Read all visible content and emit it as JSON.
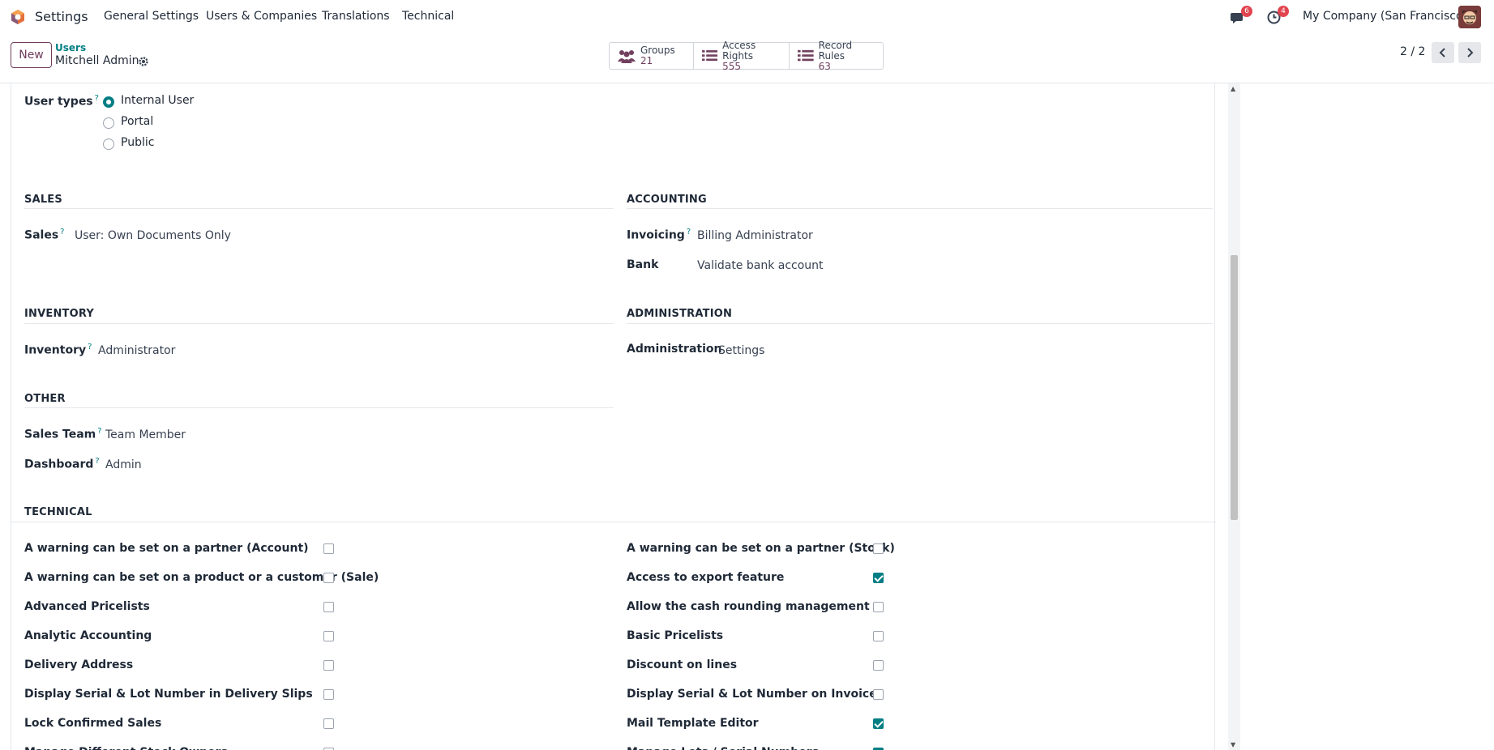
{
  "nav": {
    "app_name": "Settings",
    "menu": [
      "General Settings",
      "Users & Companies",
      "Translations",
      "Technical"
    ],
    "messages_count": "6",
    "activities_count": "4",
    "company": "My Company (San Francisco)"
  },
  "control": {
    "new_label": "New",
    "breadcrumb_parent": "Users",
    "breadcrumb_current": "Mitchell Admin",
    "smart_buttons": [
      {
        "label": "Groups",
        "value": "21",
        "icon": "users-icon"
      },
      {
        "label": "Access Rights",
        "value": "555",
        "icon": "list-icon"
      },
      {
        "label": "Record Rules",
        "value": "63",
        "icon": "list-icon"
      }
    ],
    "pager": "2 / 2"
  },
  "user_types": {
    "label": "User types",
    "help": "?",
    "options": [
      "Internal User",
      "Portal",
      "Public"
    ],
    "selected": "Internal User"
  },
  "sections": {
    "sales": {
      "title": "SALES",
      "fields": [
        {
          "label": "Sales",
          "help": "?",
          "value": "User: Own Documents Only"
        }
      ]
    },
    "accounting": {
      "title": "ACCOUNTING",
      "fields": [
        {
          "label": "Invoicing",
          "help": "?",
          "value": "Billing Administrator"
        },
        {
          "label": "Bank",
          "value": "Validate bank account"
        }
      ]
    },
    "inventory": {
      "title": "INVENTORY",
      "fields": [
        {
          "label": "Inventory",
          "help": "?",
          "value": "Administrator"
        }
      ]
    },
    "administration": {
      "title": "ADMINISTRATION",
      "fields": [
        {
          "label": "Administration",
          "value": "Settings"
        }
      ]
    },
    "other": {
      "title": "OTHER",
      "fields": [
        {
          "label": "Sales Team",
          "help": "?",
          "value": "Team Member"
        },
        {
          "label": "Dashboard",
          "help": "?",
          "value": "Admin"
        }
      ]
    }
  },
  "technical": {
    "title": "TECHNICAL",
    "left": [
      {
        "label": "A warning can be set on a partner (Account)",
        "checked": false
      },
      {
        "label": "A warning can be set on a product or a customer (Sale)",
        "checked": false
      },
      {
        "label": "Advanced Pricelists",
        "checked": false
      },
      {
        "label": "Analytic Accounting",
        "checked": false
      },
      {
        "label": "Delivery Address",
        "checked": false
      },
      {
        "label": "Display Serial & Lot Number in Delivery Slips",
        "checked": false
      },
      {
        "label": "Lock Confirmed Sales",
        "checked": false
      },
      {
        "label": "Manage Different Stock Owners",
        "checked": false
      }
    ],
    "right": [
      {
        "label": "A warning can be set on a partner (Stock)",
        "checked": false
      },
      {
        "label": "Access to export feature",
        "checked": true
      },
      {
        "label": "Allow the cash rounding management",
        "checked": false
      },
      {
        "label": "Basic Pricelists",
        "checked": false
      },
      {
        "label": "Discount on lines",
        "checked": false
      },
      {
        "label": "Display Serial & Lot Number on Invoices",
        "checked": false
      },
      {
        "label": "Mail Template Editor",
        "checked": true
      },
      {
        "label": "Manage Lots / Serial Numbers",
        "checked": true
      }
    ]
  },
  "colors": {
    "accent": "#017e84",
    "brand": "#71405f"
  }
}
